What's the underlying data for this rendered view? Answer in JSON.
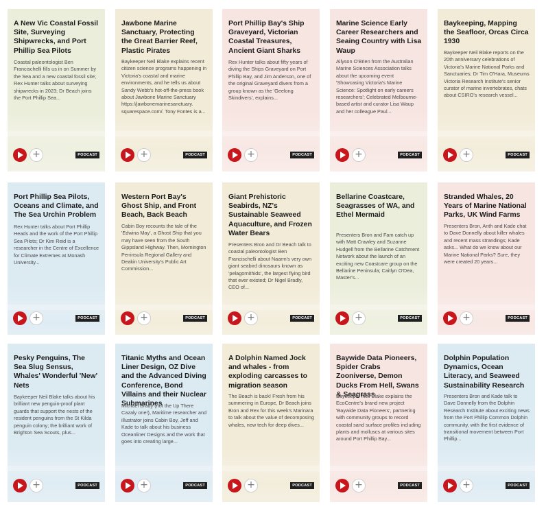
{
  "colors": {
    "green": "#eceedc",
    "tan": "#f1ebd7",
    "pink": "#f7e5e1",
    "blue": "#dceaf2",
    "play": "#c8161d",
    "badge": "#1f1f1f"
  },
  "cards": [
    {
      "color": "green",
      "title": "A New Vic Coastal Fossil Site, Surveying Shipwrecks, and Port Phillip Sea Pilots",
      "desc": "Coastal paleontologist Ben Francischelli fills us in on Summer by the Sea and a new coastal fossil site; Rex Hunter talks about surveying shipwrecks in 2023; Dr Beach joins the Port Phillip Sea...",
      "badge": "PODCAST"
    },
    {
      "color": "tan",
      "title": "Jawbone Marine Sanctuary, Protecting the Great Barrier Reef, Plastic Pirates",
      "desc": "Baykeeper Neil Blake explains recent citizen science programs happening in Victoria's coastal and marine environments, and he tells us about Sandy Webb's hot-off-the-press book about Jawbone Marine Sanctuary https://jawbonemarinesanctuary. squarespace.com/. Tony Fontes is a...",
      "badge": "PODCAST"
    },
    {
      "color": "pink",
      "title": "Port Phillip Bay's Ship Graveyard, Victorian Coastal Treasures, Ancient Giant Sharks",
      "desc": "Rex Hunter talks about fifty years of diving the Ships Graveyard on Port Phillip Bay, and Jim Anderson, one of the original Graveyard divers from a group known as the 'Geelong Skindivers', explains...",
      "badge": "PODCAST"
    },
    {
      "color": "pink",
      "title": "Marine Science Early Career Researchers and Seaing Country with Lisa Waup",
      "desc": "Allyson O'Brien from the Australian Marine Sciences Association talks about the upcoming event 'Showcasing Victoria's Marine Science: Spotlight on early careers researchers'; Celebrated Melbourne-based artist and curator Lisa Waup and her colleague Paul...",
      "badge": "PODCAST"
    },
    {
      "color": "tan",
      "title": "Baykeeping, Mapping the Seafloor, Orcas Circa 1930",
      "desc": "Baykeeper Neil Blake reports on the 20th anniversary celebrations of Victoria's Marine National Parks and Sanctuaries; Dr Tim O'Hara, Museums Victoria Research Institute's senior curator of marine invertebrates, chats about CSIRO's research vessel...",
      "badge": "PODCAST"
    },
    {
      "color": "blue",
      "title": "Port Phillip Sea Pilots, Oceans and Climate, and The Sea Urchin Problem",
      "desc": "Rex Hunter talks about Port Phillip Heads and the work of the Port Phillip Sea Pilots; Dr Kim Reid is a researcher in the Centre of Excellence for Climate Extremes at Monash University...",
      "badge": "PODCAST"
    },
    {
      "color": "tan",
      "title": "Western Port Bay's Ghost Ship, and Front Beach, Back Beach",
      "desc": "Cabin Boy recounts the tale of the 'Edwina May', a Ghost Ship that you may have seen from the South Gippsland Highway. Then, Mornington Peninsula Regional Gallery and Deakin University's Public Art Commission...",
      "badge": "PODCAST"
    },
    {
      "color": "tan",
      "title": "Giant Prehistoric Seabirds, NZ's Sustainable Seaweed Aquaculture, and Frozen Water Bears",
      "desc": "Presenters Bron and Dr Beach talk to coastal paleontologist Ben Francischelli about Naarm's very own giant seabird dinosaurs known as 'pelagornithids', the largest flying bird that ever existed; Dr Nigel Bradly, CEO of...",
      "badge": "PODCAST"
    },
    {
      "color": "green",
      "title": "Bellarine Coastcare, Seagrasses of WA, and Ethel Mermaid",
      "desc": "Presenters Bron and Fam catch up with Matt Crawley and Suzanne Hudgell from the Bellarine Catchment Network about the launch of an exciting new Coastcare group on the Bellarine Peninsula; Caitlyn O'Dea, Master's...",
      "badge": "PODCAST"
    },
    {
      "color": "pink",
      "title": "Stranded Whales, 20 Years of Marine National Parks, UK Wind Farms",
      "desc": "Presenters Bron, Anth and Kade chat to Dave Donnelly about killer whales and recent mass strandings; Kade asks... What do we know about our Marine National Parks? Sure, they were created 20 years...",
      "badge": "PODCAST"
    },
    {
      "color": "blue",
      "title": "Pesky Penguins, The Sea Slug Sensus, Whales' Wonderful 'New' Nets",
      "desc": "Baykeeper Neil Blake talks about his brilliant new penguin-proof plant guards that support the nests of the resident penguins from the St Kilda penguin colony; the brilliant work of Brighton Sea Scouts, plus...",
      "badge": "PODCAST"
    },
    {
      "color": "blue",
      "title": "Titanic Myths and Ocean Liner Design, OZ Dive and the Advanced Diving Conference, Bond Villains and their Nuclear Submarines",
      "desc": "Michael Brady (not the Up There Cazaly one!), Maritime researcher and illustrator joins Cabin Boy, Jeff and Kade to talk about his business Oceanliner Designs and the work that goes into creating large...",
      "badge": "PODCAST"
    },
    {
      "color": "tan",
      "title": "A Dolphin Named Jock and whales - from exploding carcasses to migration season",
      "desc": "The Beach is back! Fresh from his summering in Europe, Dr Beach joins Bron and Rex for this week's Marinara to talk about the value of decomposing whales, new tech for deep dives...",
      "badge": "PODCAST"
    },
    {
      "color": "pink",
      "title": "Baywide Data Pioneers, Spider Crabs Zooniverse, Demon Ducks From Hell, Swans & Seagrass",
      "desc": "Baykeeper Neil Blake explains the EcoCentre's brand new project 'Baywide Data Pioneers', partnering with community groups to record coastal sand surface profiles including plants and molluscs at various sites around Port Phillip Bay...",
      "badge": "PODCAST"
    },
    {
      "color": "blue",
      "title": "Dolphin Population Dynamics, Ocean Literacy, and Seaweed Sustainability Research",
      "desc": "Presenters Bron and Kade talk to Dave Donnelly from the Dolphin Research Institute about exciting news from the Port Phillip Common Dolphin community, with the first evidence of transitional movement between Port Phillip...",
      "badge": "PODCAST"
    }
  ]
}
